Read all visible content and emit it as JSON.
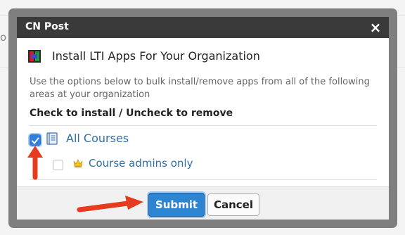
{
  "background": {
    "partial_char": "o"
  },
  "dialog": {
    "title": "CN Post",
    "close_glyph": "×",
    "heading": "Install LTI Apps For Your Organization",
    "description": "Use the options below to bulk install/remove apps from all of the following areas at your organization",
    "subheading": "Check to install / Uncheck to remove",
    "options": [
      {
        "label": "All Courses",
        "checked": true,
        "icon": "course-book-icon"
      },
      {
        "label": "Course admins only",
        "checked": false,
        "icon": "crown-icon"
      }
    ],
    "buttons": {
      "submit": "Submit",
      "cancel": "Cancel"
    }
  },
  "colors": {
    "accent": "#2d85d2",
    "link": "#2f6fa8",
    "annotation_arrow": "#e63b1f"
  }
}
